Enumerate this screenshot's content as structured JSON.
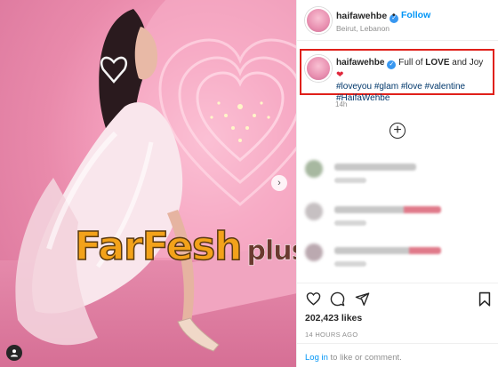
{
  "post": {
    "username": "haifawehbe",
    "follow_label": "Follow",
    "separator": "•",
    "location": "Beirut, Lebanon"
  },
  "caption": {
    "username": "haifawehbe",
    "text_before": "Full of ",
    "text_bold": "LOVE",
    "text_after": " and Joy ",
    "heart": "❤",
    "hashtags": [
      "#loveyou",
      "#glam",
      "#love",
      "#valentine",
      "#HaifaWehbe"
    ],
    "time": "14h"
  },
  "load_more_symbol": "+",
  "engagement": {
    "likes": "202,423 likes",
    "posted": "14 HOURS AGO"
  },
  "footer": {
    "login_label": "Log in",
    "rest": " to like or comment."
  },
  "watermark": {
    "main": "FarFesh",
    "plus": "plus.com"
  },
  "media": {
    "next_arrow": "›"
  },
  "colors": {
    "accent": "#0095f6",
    "verified": "#3897f0",
    "highlight_box": "#e0201a",
    "watermark_orange": "#f3a21a"
  },
  "icons": [
    "verified-badge-icon",
    "plus-circle-icon",
    "heart-icon",
    "comment-icon",
    "share-icon",
    "bookmark-icon",
    "next-arrow-icon",
    "tag-user-icon"
  ]
}
